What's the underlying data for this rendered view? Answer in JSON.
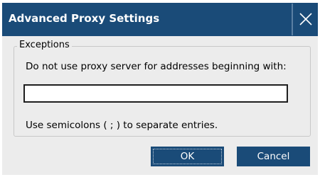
{
  "window": {
    "title": "Advanced Proxy Settings",
    "close_icon": "close-icon",
    "accent_color": "#1a4b78"
  },
  "exceptions": {
    "group_label": "Exceptions",
    "instruction": "Do not use proxy server for addresses beginning with:",
    "input_value": "",
    "hint": "Use semicolons ( ; ) to separate entries."
  },
  "buttons": {
    "ok_label": "OK",
    "cancel_label": "Cancel"
  }
}
